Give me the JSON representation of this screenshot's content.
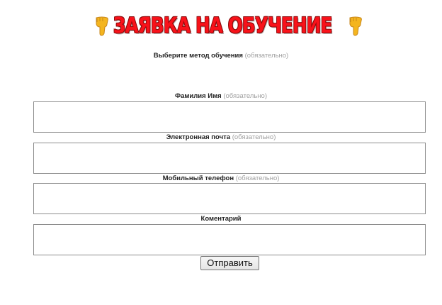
{
  "header": {
    "title": "ЗАЯВКА НА ОБУЧЕНИЕ",
    "left_icon": "hand-pointing-down-icon",
    "right_icon": "hand-pointing-down-icon",
    "accent_color": "#f8121a"
  },
  "form": {
    "required_note": "(обязательно)",
    "method": {
      "label": "Выберите метод обучения"
    },
    "name": {
      "label": "Фамилия Имя",
      "value": ""
    },
    "email": {
      "label": "Электронная почта",
      "value": ""
    },
    "phone": {
      "label": "Мобильный телефон",
      "value": ""
    },
    "comment": {
      "label": "Коментарий",
      "value": ""
    },
    "submit_label": "Отправить"
  }
}
